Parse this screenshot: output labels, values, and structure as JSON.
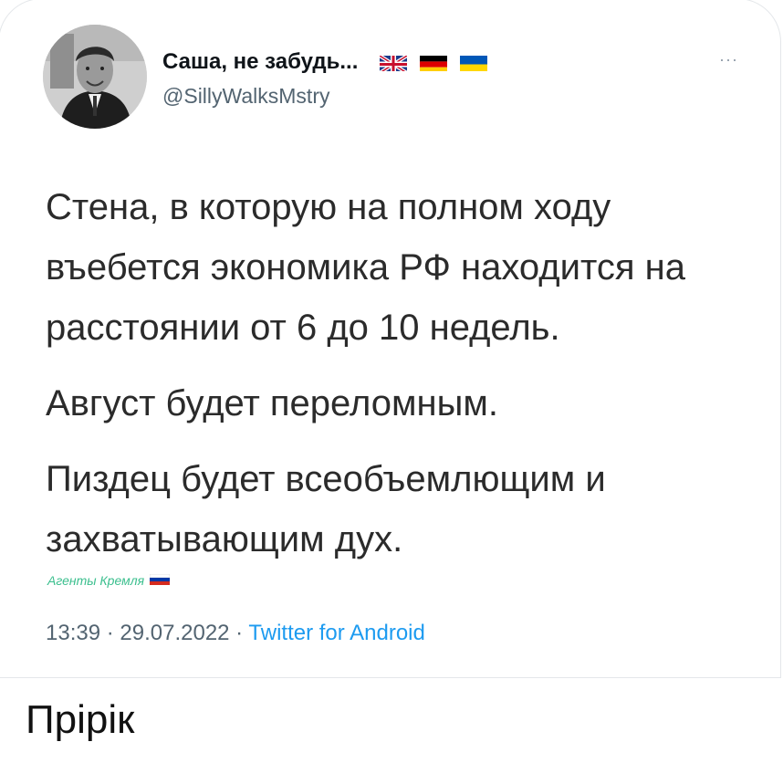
{
  "tweet": {
    "display_name": "Саша, не забудь...",
    "handle": "@SillyWalksMstry",
    "more_label": "···",
    "paragraphs": [
      "Стена, в которую на полном ходу въебется экономика РФ находится на расстоянии от 6 до 10 недель.",
      "Август будет переломным.",
      "Пиздец будет всеобъемлющим и захватывающим дух."
    ],
    "time": "13:39",
    "date": "29.07.2022",
    "separator": " · ",
    "source": "Twitter for Android",
    "flags": [
      "uk-flag-icon",
      "germany-flag-icon",
      "ukraine-flag-icon"
    ]
  },
  "watermark": {
    "text": "Агенты Кремля",
    "flag": "russia-flag-icon"
  },
  "caption": "Прірік",
  "colors": {
    "handle": "#536471",
    "source": "#1d9bf0",
    "watermark": "#3bbf8e"
  }
}
